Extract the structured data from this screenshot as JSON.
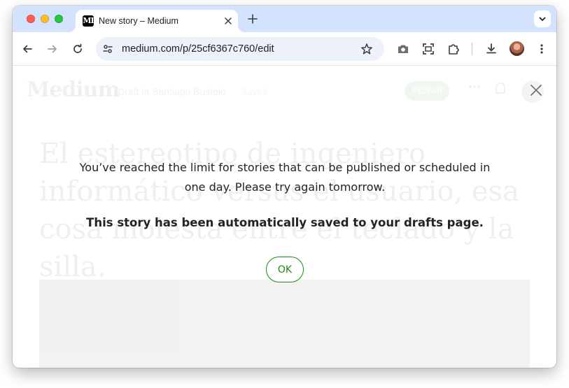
{
  "browser": {
    "tab": {
      "favicon_text": "M",
      "title": "New story – Medium"
    },
    "url": "medium.com/p/25cf6367c760/edit"
  },
  "background_page": {
    "logo": "Medium",
    "draft_label": "Draft in Santiago Bustelo",
    "saved_label": "Saved",
    "publish_label": "Publish",
    "headline": "El estereotipo de ingeniero informático versus el usuario, esa cosa molesta entre el teclado y la silla."
  },
  "dialog": {
    "message": "You’ve reached the limit for stories that can be published or scheduled in one day. Please try again tomorrow.",
    "bold_message": "This story has been automatically saved to your drafts page.",
    "ok_label": "OK"
  },
  "colors": {
    "tabstrip": "#d3e3fd",
    "omnibox": "#edf2fa",
    "medium_green": "#1a8917",
    "text": "#242424"
  }
}
